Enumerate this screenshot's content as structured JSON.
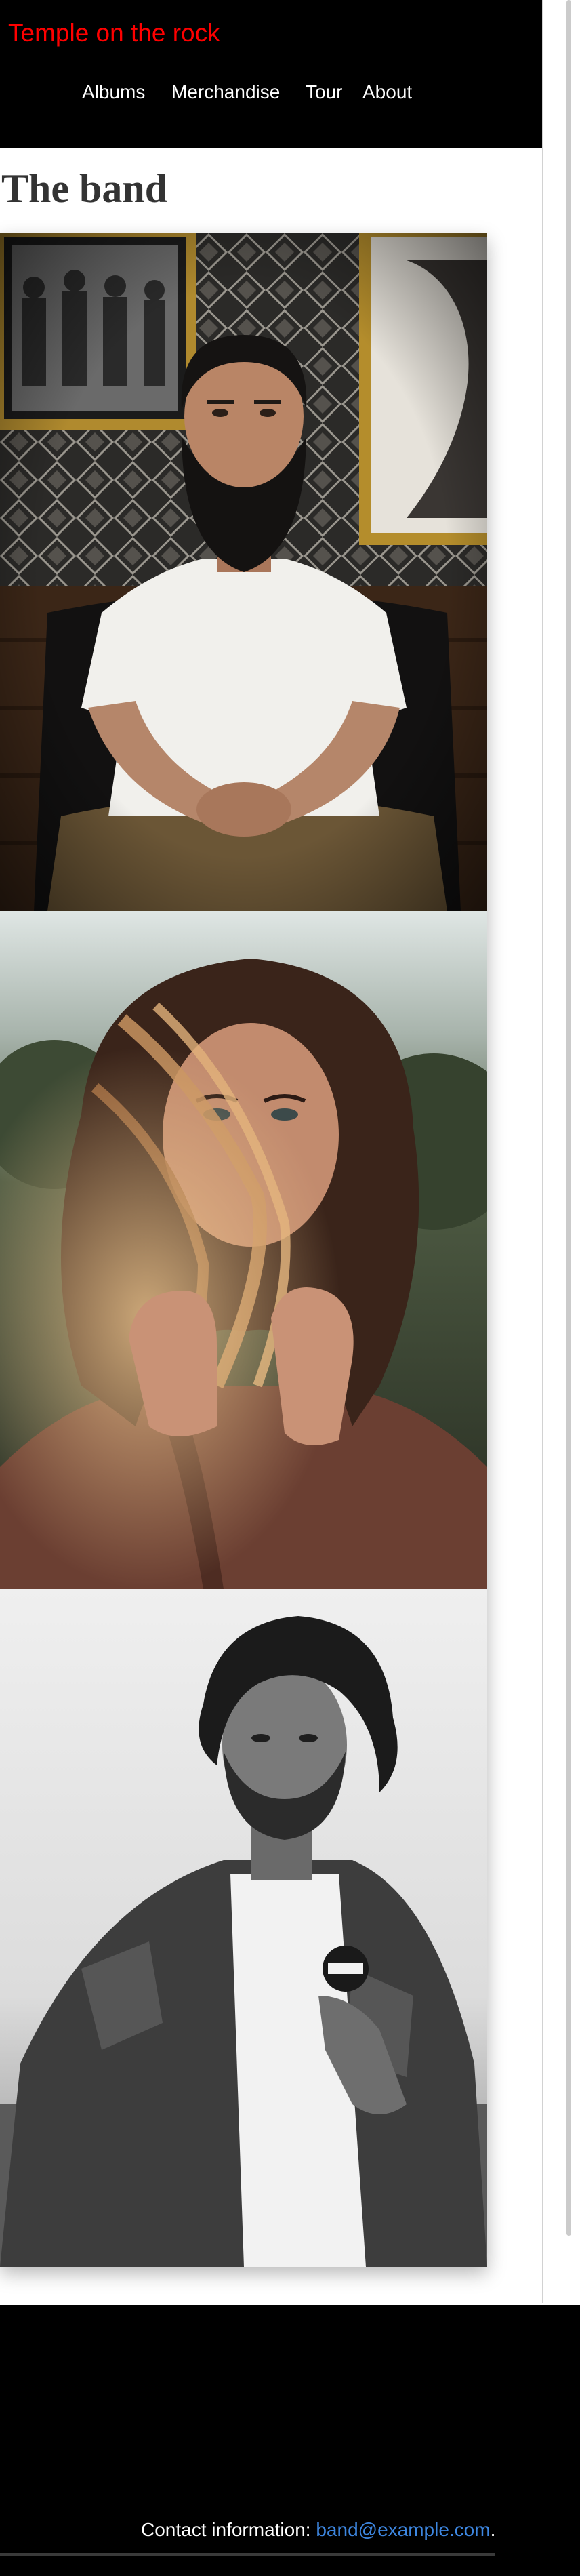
{
  "header": {
    "site_title": "Temple on the rock",
    "nav": [
      {
        "label": "Albums"
      },
      {
        "label": "Merchandise"
      },
      {
        "label": "Tour"
      },
      {
        "label": "About"
      }
    ]
  },
  "main": {
    "heading": "The band",
    "photos": [
      {
        "subject": "bearded man in white t-shirt seated in a leather armchair"
      },
      {
        "subject": "woman with windswept hair holding a brown jacket collar"
      },
      {
        "subject": "black-and-white portrait of man in denim jacket"
      }
    ]
  },
  "footer": {
    "contact_label": "Contact information:",
    "email": "band@example.com",
    "trailing": "."
  },
  "colors": {
    "header_bg": "#000000",
    "site_title": "#ff0000",
    "nav_text": "#ffffff",
    "heading_text": "#333333",
    "footer_bg": "#000000",
    "link": "#3d86e0"
  }
}
